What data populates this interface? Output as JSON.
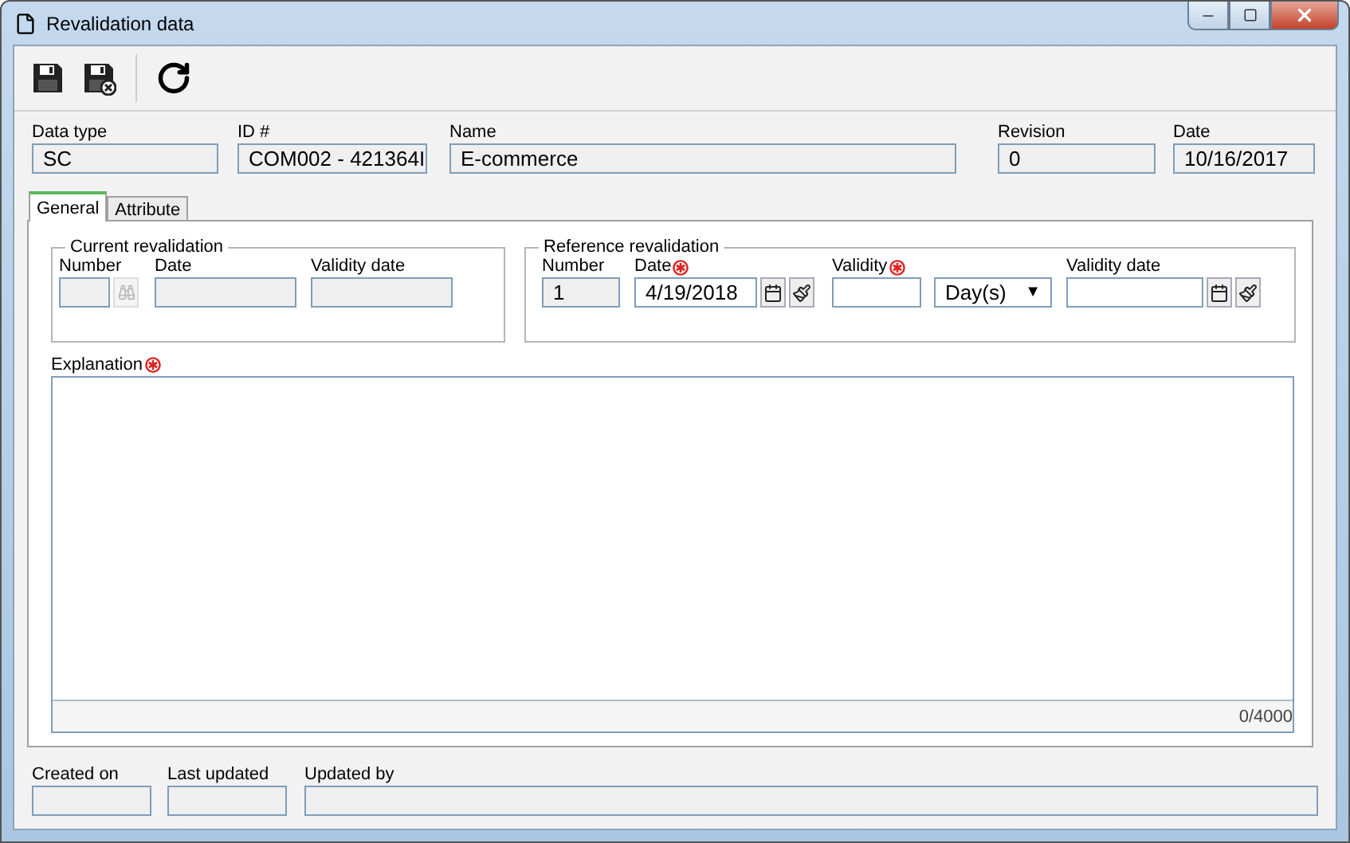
{
  "window": {
    "title": "Revalidation data"
  },
  "header_fields": [
    {
      "label": "Data type",
      "value": "SC",
      "readonly": true
    },
    {
      "label": "ID #",
      "value": "COM002 - 421364I",
      "readonly": true
    },
    {
      "label": "Name",
      "value": "E-commerce",
      "readonly": true
    },
    {
      "label": "Revision",
      "value": "0",
      "readonly": true
    },
    {
      "label": "Date",
      "value": "10/16/2017",
      "readonly": true
    }
  ],
  "tabs": [
    {
      "label": "General",
      "selected": true
    },
    {
      "label": "Attribute",
      "selected": false
    }
  ],
  "current_revalidation": {
    "title": "Current revalidation",
    "fields": [
      {
        "kind": "lookup",
        "label": "Number",
        "readonly": true,
        "required": false
      },
      {
        "kind": "text",
        "label": "Date",
        "readonly": true,
        "required": false
      },
      {
        "kind": "text",
        "label": "Validity date",
        "readonly": true,
        "required": false
      }
    ]
  },
  "reference_revalidation": {
    "title": "Reference revalidation",
    "fields": [
      {
        "kind": "text",
        "label": "Number",
        "value": "1",
        "readonly": true,
        "required": false
      },
      {
        "kind": "date",
        "label": "Date",
        "value": "4/19/2018",
        "readonly": false,
        "required": true
      },
      {
        "kind": "text",
        "label": "Validity",
        "readonly": false,
        "required": true
      },
      {
        "kind": "select",
        "value": "Day(s)",
        "dropdown": "▼",
        "readonly": false
      },
      {
        "kind": "date",
        "label": "Validity date",
        "readonly": false,
        "required": false
      }
    ]
  },
  "explanation": {
    "label": "Explanation",
    "required": true,
    "counter": "0/4000"
  },
  "footer_fields": [
    {
      "label": "Created on",
      "readonly": true
    },
    {
      "label": "Last updated",
      "readonly": true
    },
    {
      "label": "Updated by",
      "readonly": true
    }
  ]
}
